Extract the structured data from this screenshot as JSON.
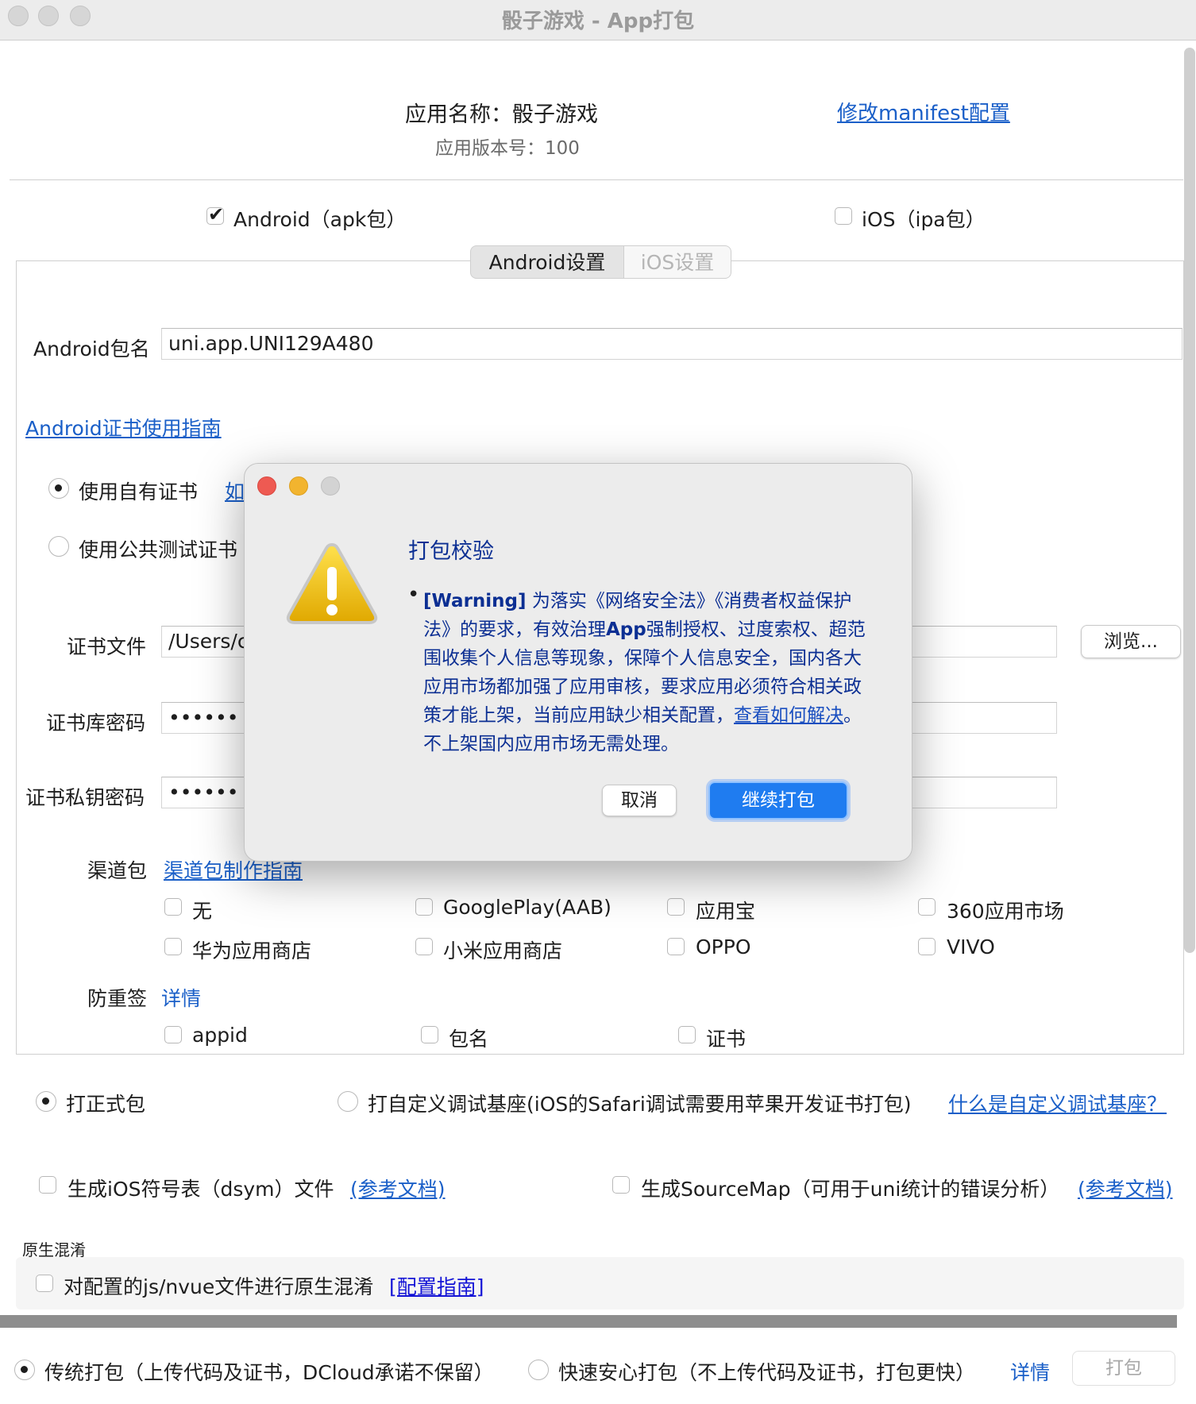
{
  "window": {
    "title": "骰子游戏 - App打包"
  },
  "header": {
    "app_name": "应用名称：骰子游戏",
    "app_version": "应用版本号：100",
    "manifest_link": "修改manifest配置"
  },
  "platforms": {
    "android": {
      "label": "Android（apk包）",
      "checked": true
    },
    "ios": {
      "label": "iOS（ipa包）",
      "checked": false
    }
  },
  "tabs": [
    {
      "label": "Android设置",
      "active": true
    },
    {
      "label": "iOS设置",
      "active": false
    }
  ],
  "android": {
    "package_label": "Android包名",
    "package_value": "uni.app.UNI129A480",
    "cert_guide_link": "Android证书使用指南",
    "cert_own": "使用自有证书",
    "cert_own_link": "如",
    "cert_public": "使用公共测试证书",
    "cert_file_label": "证书文件",
    "cert_file_value": "/Users/c",
    "browse_button": "浏览...",
    "keystore_pwd_label": "证书库密码",
    "keystore_pwd_value": "••••••",
    "key_pwd_label": "证书私钥密码",
    "key_pwd_value": "••••••",
    "channel_label": "渠道包",
    "channel_link": "渠道包制作指南",
    "channels": [
      "无",
      "GooglePlay(AAB)",
      "应用宝",
      "360应用市场",
      "华为应用商店",
      "小米应用商店",
      "OPPO",
      "VIVO"
    ],
    "anti_label": "防重签",
    "anti_link": "详情",
    "anti_items": [
      "appid",
      "包名",
      "证书"
    ]
  },
  "build_type": {
    "release": "打正式包",
    "custom_base": "打自定义调试基座(iOS的Safari调试需要用苹果开发证书打包)",
    "custom_base_link": "什么是自定义调试基座？"
  },
  "options": {
    "dsym": "生成iOS符号表（dsym）文件",
    "dsym_link": "(参考文档)",
    "sourcemap": "生成SourceMap（可用于uni统计的错误分析）",
    "sourcemap_link": "(参考文档)"
  },
  "obfuscation": {
    "section_title": "原生混淆",
    "label": "对配置的js/nvue文件进行原生混淆",
    "link": "[配置指南]"
  },
  "footer": {
    "traditional": "传统打包（上传代码及证书，DCloud承诺不保留）",
    "fast": "快速安心打包（不上传代码及证书，打包更快）",
    "details_link": "详情",
    "pack_button": "打包"
  },
  "dialog": {
    "title": "打包校验",
    "warning_tag": "[Warning]",
    "message_part1": " 为落实《网络安全法》《消费者权益保护法》的要求，有效治理",
    "message_bold": "App",
    "message_part2": "强制授权、过度索权、超范围收集个人信息等现象，保障个人信息安全，国内各大应用市场都加强了应用审核，要求应用必须符合相关政策才能上架，当前应用缺少相关配置，",
    "message_link": "查看如何解决",
    "message_part3": "。不上架国内应用市场无需处理。",
    "cancel_button": "取消",
    "continue_button": "继续打包"
  },
  "colors": {
    "link": "#1a5fc8",
    "dialog_text": "#0c2f93",
    "primary_button": "#1f7cf0",
    "close_light": "#ee5a52",
    "minimize_light": "#f2b42f"
  }
}
